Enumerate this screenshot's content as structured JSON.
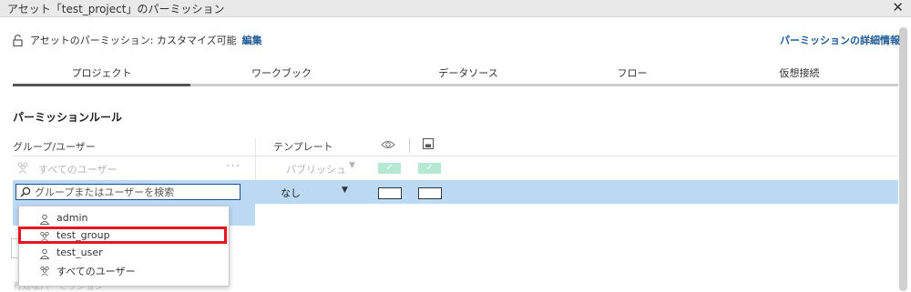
{
  "dialog": {
    "title": "アセット「test_project」のパーミッション",
    "close_glyph": "✕"
  },
  "asset_permission": {
    "label": "アセットのパーミッション: カスタマイズ可能",
    "edit_link": "編集",
    "detail_link": "パーミッションの詳細情報"
  },
  "tabs": [
    {
      "label": "プロジェクト",
      "active": true
    },
    {
      "label": "ワークブック",
      "active": false
    },
    {
      "label": "データソース",
      "active": false
    },
    {
      "label": "フロー",
      "active": false
    },
    {
      "label": "仮想接続",
      "active": false
    }
  ],
  "rules": {
    "title": "パーミッションルール",
    "column_group_user": "グループ/ユーザー",
    "column_template": "テンプレート",
    "capability_icons": [
      "eye-icon",
      "save-icon"
    ],
    "rows": [
      {
        "name": "すべてのユーザー",
        "more": "···",
        "template": "パブリッシュ",
        "checks": [
          "✓",
          "✓"
        ]
      }
    ],
    "editing_row": {
      "search_placeholder": "グループまたはユーザーを検索",
      "template": "なし"
    }
  },
  "dropdown": {
    "items": [
      {
        "label": "admin",
        "icon": "user-icon"
      },
      {
        "label": "test_group",
        "icon": "group-icon",
        "highlighted": true
      },
      {
        "label": "test_user",
        "icon": "user-icon"
      },
      {
        "label": "すべてのユーザー",
        "icon": "group-icon"
      }
    ]
  },
  "background": {
    "faded_text": "有効なパーミッション"
  },
  "colors": {
    "link": "#1f5b96",
    "selected_row": "#bcd9f4",
    "check_fill": "#b5e8d3",
    "highlight_border": "#e8131c"
  }
}
